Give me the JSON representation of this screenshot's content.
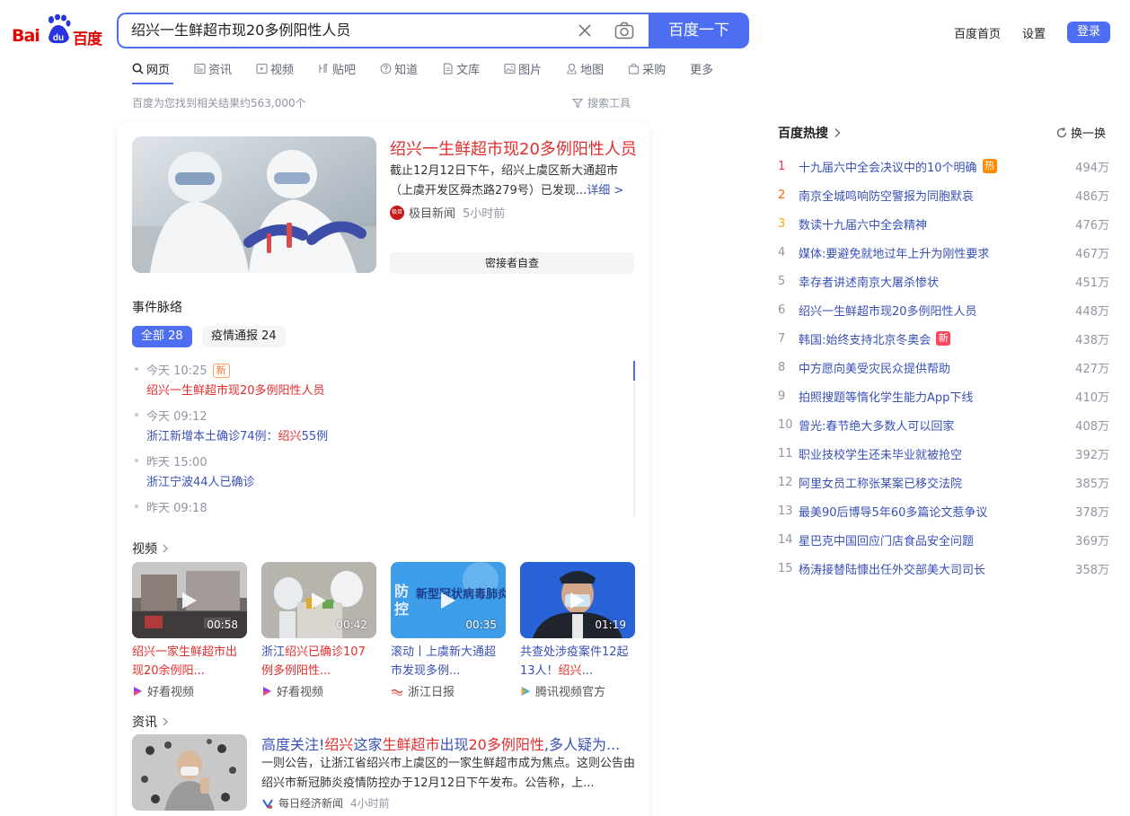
{
  "logo": {
    "left": "Bai",
    "right": "百度"
  },
  "search": {
    "query": "绍兴一生鲜超市现20多例阳性人员",
    "button": "百度一下"
  },
  "top_links": {
    "home": "百度首页",
    "settings": "设置",
    "login": "登录"
  },
  "tabs": [
    {
      "label": "网页",
      "icon": "search-icon"
    },
    {
      "label": "资讯",
      "icon": "news-icon"
    },
    {
      "label": "视频",
      "icon": "video-icon"
    },
    {
      "label": "贴吧",
      "icon": "tieba-icon"
    },
    {
      "label": "知道",
      "icon": "question-icon"
    },
    {
      "label": "文库",
      "icon": "doc-icon"
    },
    {
      "label": "图片",
      "icon": "image-icon"
    },
    {
      "label": "地图",
      "icon": "map-icon"
    },
    {
      "label": "采购",
      "icon": "cart-icon"
    },
    {
      "label": "更多",
      "icon": ""
    }
  ],
  "result_count": "百度为您找到相关结果约563,000个",
  "search_tools": "搜索工具",
  "hero": {
    "title": "绍兴一生鲜超市现20多例阳性人员",
    "desc": "截止12月12日下午，绍兴上虞区新大通超市（上虞开发区舜杰路279号）已发现...",
    "more": "详细 >",
    "source": "极目新闻",
    "source_badge": "极目",
    "time": "5小时前",
    "tag": "密接者自查"
  },
  "timeline": {
    "heading": "事件脉络",
    "filters": [
      "全部 28",
      "疫情通报 24"
    ],
    "items": [
      {
        "time": "今天 10:25",
        "badge": "新",
        "text": "绍兴一生鲜超市现20多例阳性人员"
      },
      {
        "time": "今天 09:12",
        "text_a": "浙江新增本土确诊74例：",
        "text_hl": "绍兴",
        "text_b": "55例"
      },
      {
        "time": "昨天 15:00",
        "text": "浙江宁波44人已确诊"
      },
      {
        "time": "昨天 09:18"
      }
    ]
  },
  "videos": {
    "heading": "视频",
    "items": [
      {
        "duration": "00:58",
        "title_a": "绍兴一家生鲜超市",
        "title_b": "出现20余例阳...",
        "source": "好看视频"
      },
      {
        "duration": "00:42",
        "title_a": "浙江",
        "title_hl": "绍兴",
        "title_b": "已确诊107例多例阳性...",
        "source": "好看视频"
      },
      {
        "duration": "00:35",
        "title_a": "滚动丨上虞新大通超市发现多例...",
        "source": "浙江日报",
        "thumb_text": "新型冠状病毒肺炎疫情"
      },
      {
        "duration": "01:19",
        "title_a": "共查处涉疫案件12起13人！",
        "title_hl": "绍兴",
        "title_b": "...",
        "source": "腾讯视频官方"
      }
    ]
  },
  "news": {
    "heading": "资讯",
    "title_a": "高度关注!",
    "title_hl1": "绍兴",
    "title_b": "这家",
    "title_hl2": "生鲜超市",
    "title_c": "出现",
    "title_hl3": "20多例阳性",
    "title_d": ",多人疑为...",
    "desc": "一则公告，让浙江省绍兴市上虞区的一家生鲜超市成为焦点。这则公告由绍兴市新冠肺炎疫情防控办于12月12日下午发布。公告称，上...",
    "source": "每日经济新闻",
    "time": "4小时前"
  },
  "hot": {
    "heading": "百度热搜",
    "refresh": "换一换",
    "items": [
      {
        "rank": "1",
        "title": "十九届六中全会决议中的10个明确",
        "badge": "热",
        "count": "494万"
      },
      {
        "rank": "2",
        "title": "南京全城鸣响防空警报为同胞默哀",
        "count": "486万"
      },
      {
        "rank": "3",
        "title": "数读十九届六中全会精神",
        "count": "476万"
      },
      {
        "rank": "4",
        "title": "媒体:要避免就地过年上升为刚性要求",
        "count": "467万"
      },
      {
        "rank": "5",
        "title": "幸存者讲述南京大屠杀惨状",
        "count": "451万"
      },
      {
        "rank": "6",
        "title": "绍兴一生鲜超市现20多例阳性人员",
        "count": "448万"
      },
      {
        "rank": "7",
        "title": "韩国:始终支持北京冬奥会",
        "badge": "新",
        "count": "438万"
      },
      {
        "rank": "8",
        "title": "中方愿向美受灾民众提供帮助",
        "count": "427万"
      },
      {
        "rank": "9",
        "title": "拍照搜题等惰化学生能力App下线",
        "count": "410万"
      },
      {
        "rank": "10",
        "title": "曾光:春节绝大多数人可以回家",
        "count": "408万"
      },
      {
        "rank": "11",
        "title": "职业技校学生还未毕业就被抢空",
        "count": "392万"
      },
      {
        "rank": "12",
        "title": "阿里女员工称张某案已移交法院",
        "count": "385万"
      },
      {
        "rank": "13",
        "title": "最美90后博导5年60多篇论文惹争议",
        "count": "378万"
      },
      {
        "rank": "14",
        "title": "星巴克中国回应门店食品安全问题",
        "count": "369万"
      },
      {
        "rank": "15",
        "title": "杨涛接替陆慷出任外交部美大司司长",
        "count": "358万"
      }
    ]
  },
  "colors": {
    "accent": "#4e6ef2",
    "red": "#e22d2d",
    "link": "#3951b6",
    "rank1": "#fe2d46",
    "rank2": "#f60",
    "rank3": "#faa90e"
  }
}
